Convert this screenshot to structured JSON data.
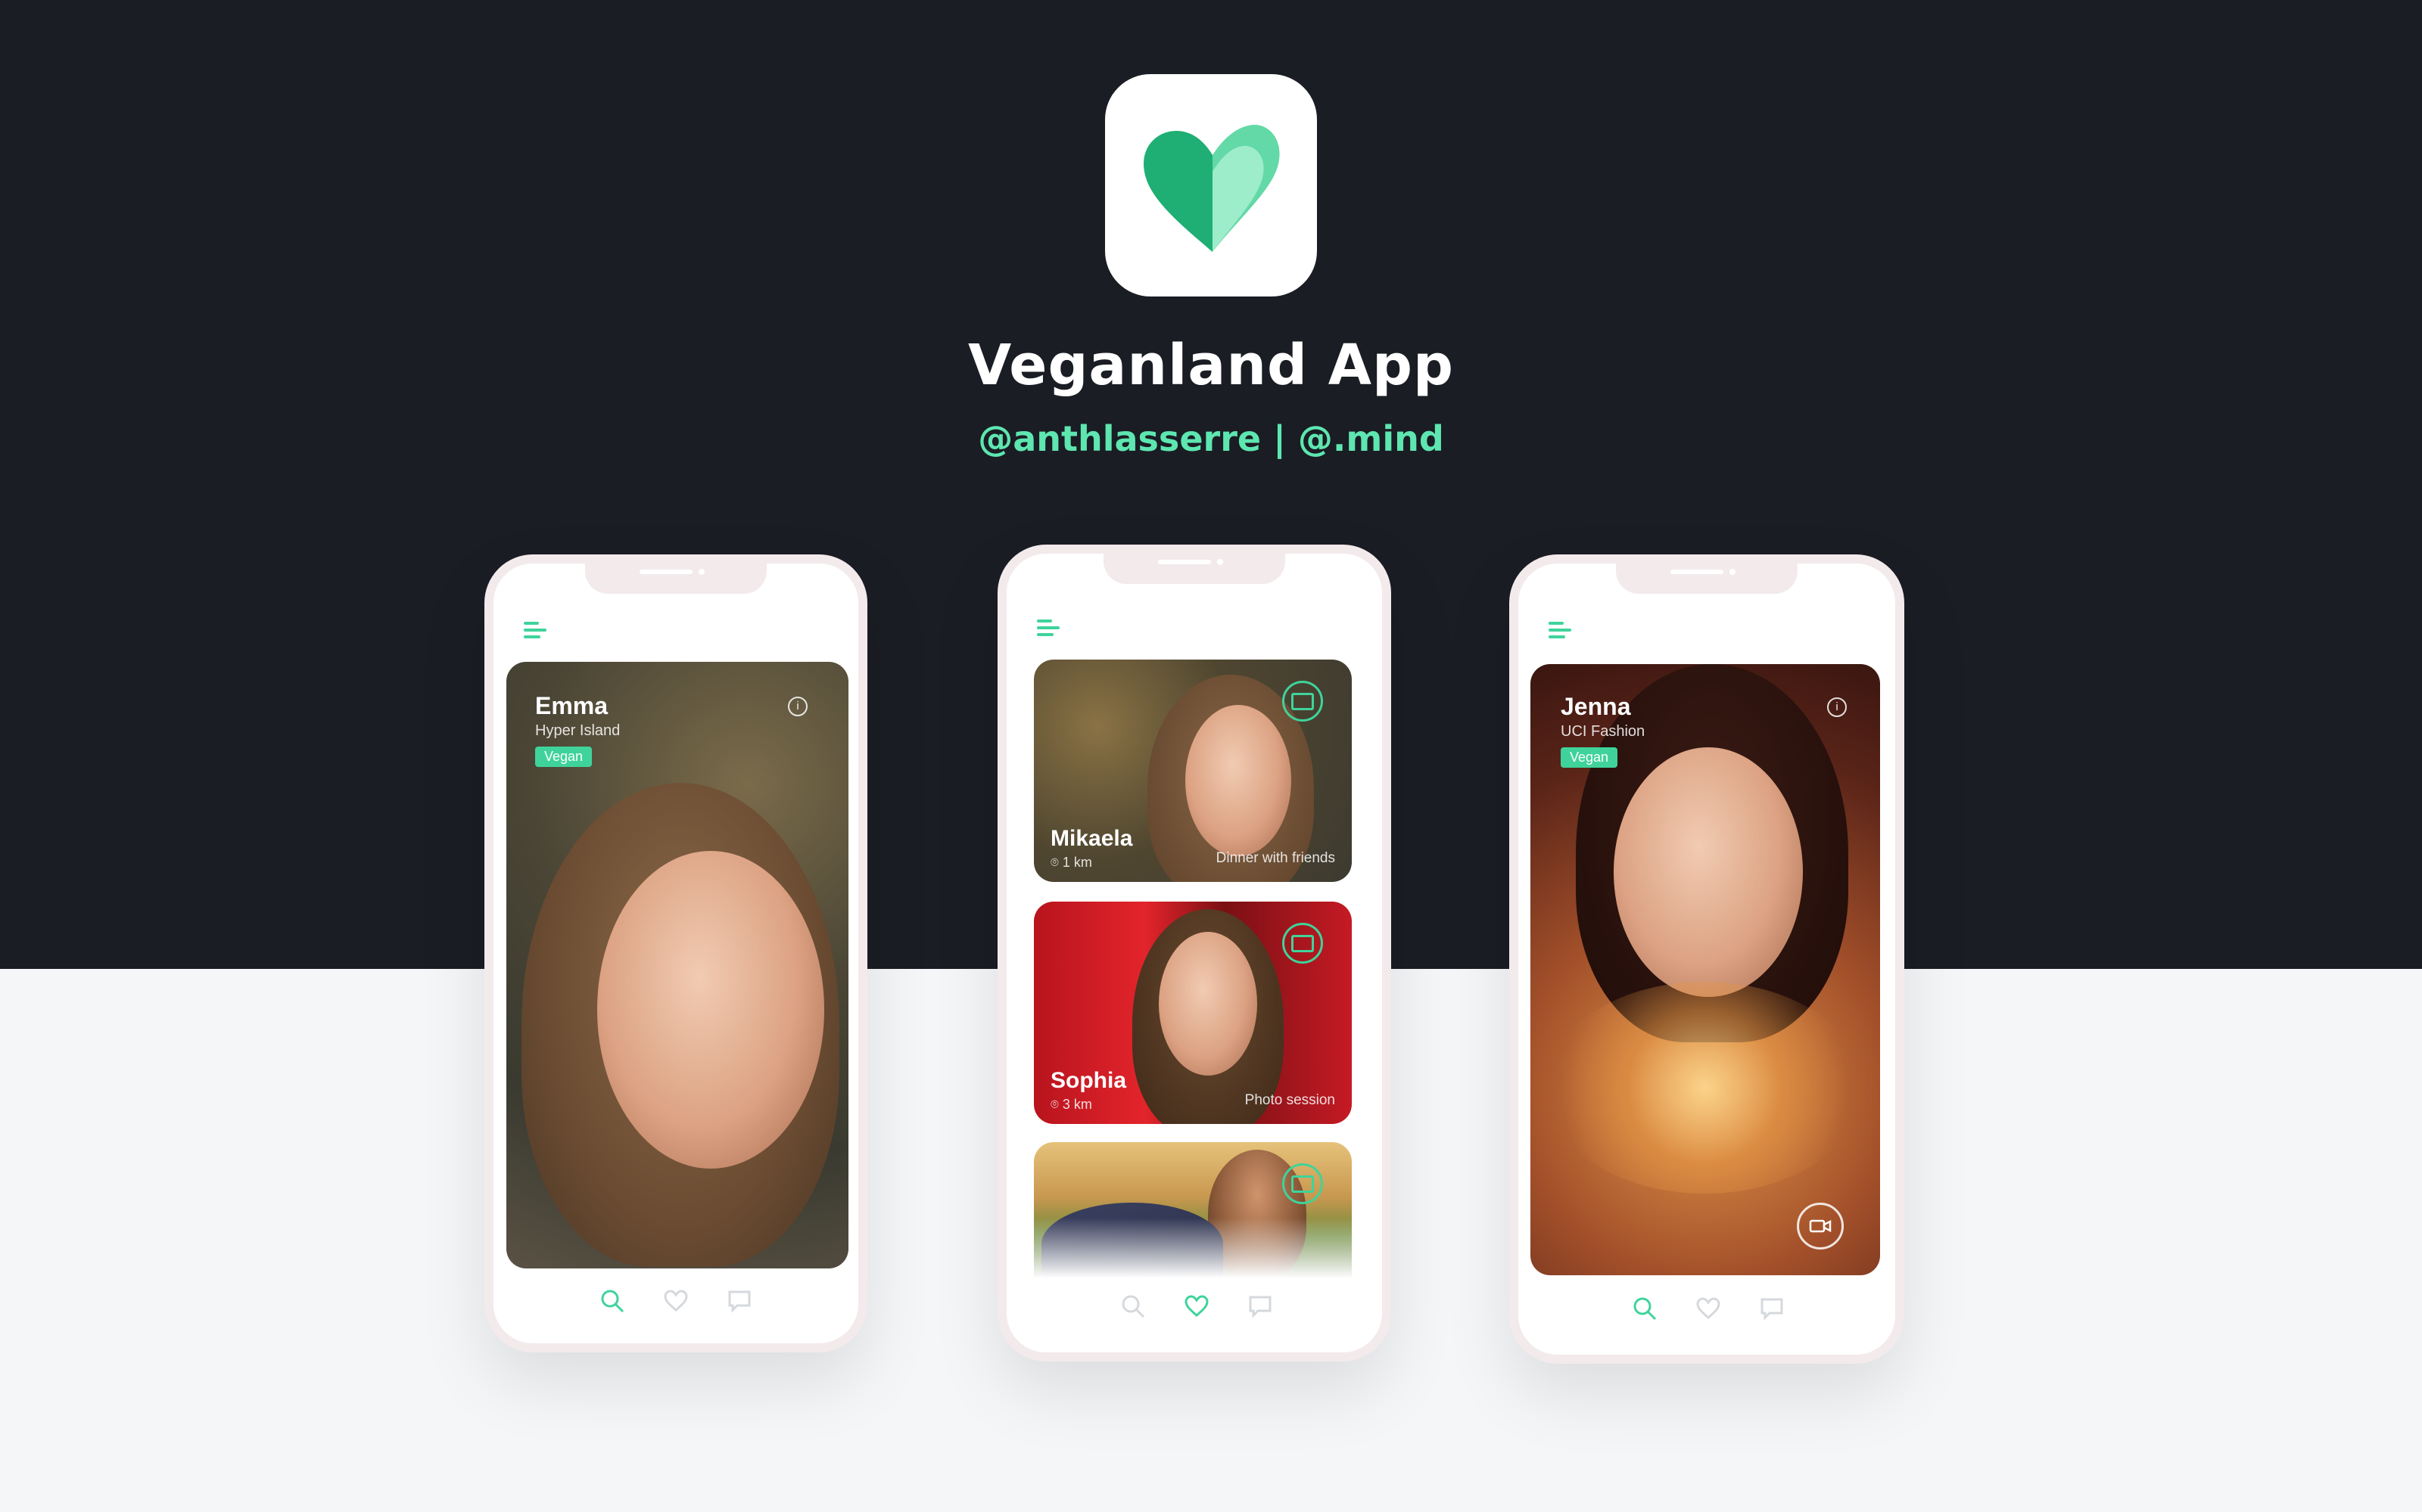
{
  "header": {
    "title": "Veganland App",
    "credits": "@anthlasserre | @.mind"
  },
  "colors": {
    "accent": "#3fd39b",
    "dark_band": "#1a1d23",
    "light_bg": "#f5f6f8",
    "phone_frame": "#f3eaec"
  },
  "phones": {
    "left": {
      "profile": {
        "name": "Emma",
        "subtitle": "Hyper Island",
        "badge": "Vegan"
      },
      "active_nav": "search-icon"
    },
    "center": {
      "cards": [
        {
          "name": "Mikaela",
          "distance": "1 km",
          "activity": "Dinner with friends"
        },
        {
          "name": "Sophia",
          "distance": "3 km",
          "activity": "Photo session"
        }
      ],
      "active_nav": "heart-icon"
    },
    "right": {
      "profile": {
        "name": "Jenna",
        "subtitle": "UCI Fashion",
        "badge": "Vegan"
      },
      "active_nav": "search-icon"
    }
  },
  "icons": [
    "app-logo-heart-icon",
    "menu-icon",
    "info-icon",
    "chat-icon",
    "location-pin-icon",
    "video-icon",
    "search-icon",
    "heart-icon",
    "message-icon"
  ]
}
